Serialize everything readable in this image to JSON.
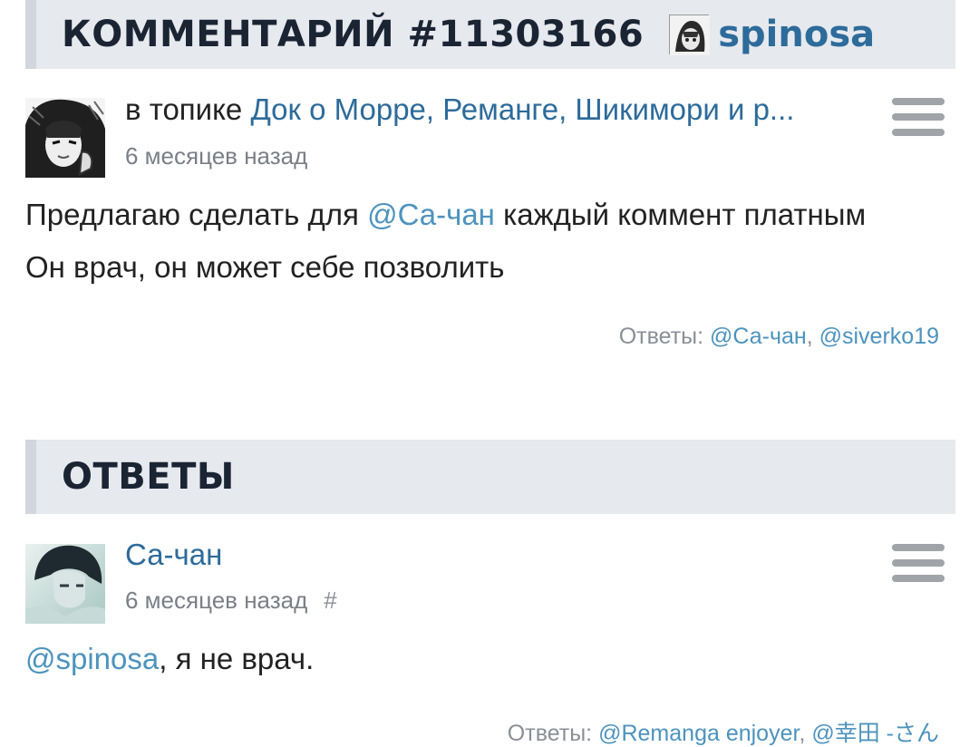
{
  "comment_header": {
    "title": "КОММЕНТАРИЙ #11303166",
    "username": "spinosa"
  },
  "comment": {
    "topic_prefix": "в топике",
    "topic_title": "Док о Морре, Реманге, Шикимори и р...",
    "time": "6 месяцев назад",
    "line1_before": "Предлагаю сделать для ",
    "line1_mention": "@Са-чан",
    "line1_after": " каждый коммент платным",
    "line2": "Он врач, он может себе позволить",
    "replies_label": "Ответы:",
    "replies": [
      "@Са-чан",
      "@siverko19"
    ]
  },
  "answers_header": {
    "title": "ОТВЕТЫ"
  },
  "answer": {
    "author": "Са-чан",
    "time": "6 месяцев назад",
    "hash": "#",
    "mention": "@spinosa",
    "text": ", я не врач.",
    "replies_label": "Ответы:",
    "replies": [
      "@Remanga enjoyer",
      "@幸田 -さん"
    ]
  },
  "icons": {
    "menu": "hamburger-menu-icon"
  },
  "colors": {
    "header_bg": "#e6e9ee",
    "link": "#2d6b9a",
    "mention": "#4d93bd",
    "muted": "#7a7f86"
  }
}
